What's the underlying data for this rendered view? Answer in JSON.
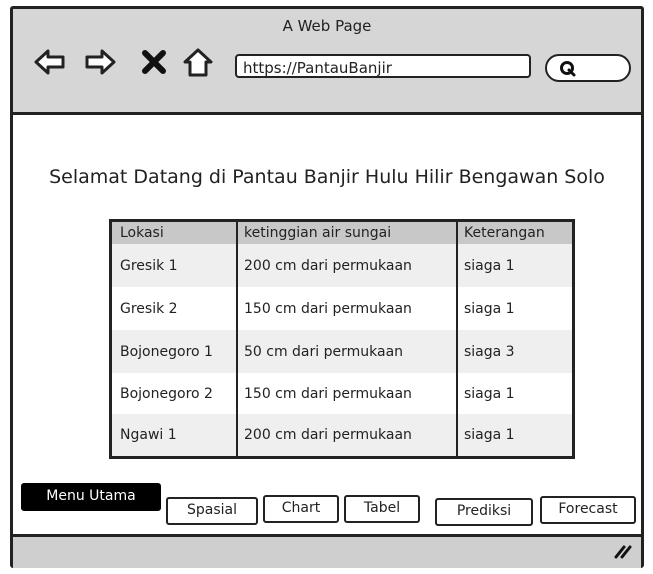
{
  "window": {
    "title": "A Web Page"
  },
  "toolbar": {
    "url": "https://PantauBanjir",
    "icons": [
      "back-arrow-icon",
      "forward-arrow-icon",
      "close-icon",
      "home-icon",
      "search-icon"
    ]
  },
  "page": {
    "heading": "Selamat Datang di Pantau Banjir Hulu Hilir Bengawan Solo"
  },
  "table": {
    "columns": [
      "Lokasi",
      "ketinggian air sungai",
      "Keterangan"
    ],
    "rows": [
      [
        "Gresik 1",
        "200 cm dari permukaan",
        "siaga 1"
      ],
      [
        "Gresik 2",
        "150 cm dari permukaan",
        "siaga 1"
      ],
      [
        "Bojonegoro 1",
        "50 cm dari permukaan",
        "siaga 3"
      ],
      [
        "Bojonegoro 2",
        "150 cm dari permukaan",
        "siaga 1"
      ],
      [
        "Ngawi 1",
        "200 cm dari permukaan",
        "siaga 1"
      ]
    ]
  },
  "tabs": {
    "menu_utama": "Menu Utama",
    "spasial": "Spasial",
    "chart": "Chart",
    "tabel": "Tabel",
    "prediksi": "Prediksi",
    "forecast": "Forecast"
  }
}
